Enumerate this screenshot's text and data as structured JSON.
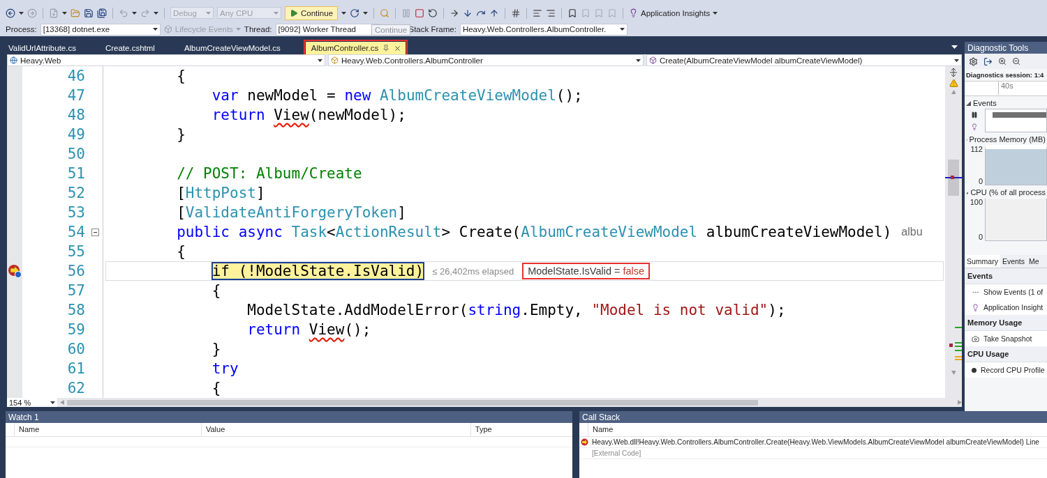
{
  "toolbar": {
    "configuration": {
      "value": "Debug",
      "disabled": true
    },
    "platform": {
      "value": "Any CPU",
      "disabled": true
    },
    "continue_button": "Continue",
    "insights": "Application Insights"
  },
  "debug_location": {
    "process_label": "Process:",
    "process": "[13368] dotnet.exe",
    "lifecycle": {
      "label": "Lifecycle Events",
      "disabled": true
    },
    "thread_label": "Thread:",
    "thread": "[9092] Worker Thread",
    "tooltip": "Continue",
    "stack_frame_label": "Stack Frame:",
    "stack_frame": "Heavy.Web.Controllers.AlbumController."
  },
  "tabs": [
    {
      "label": "ValidUrlAttribute.cs",
      "selected": false,
      "annotated": false
    },
    {
      "label": "Create.cshtml",
      "selected": false,
      "annotated": false
    },
    {
      "label": "AlbumCreateViewModel.cs",
      "selected": false,
      "annotated": false
    },
    {
      "label": "AlbumController.cs",
      "selected": true,
      "annotated": true
    }
  ],
  "navigation": {
    "project": "Heavy.Web",
    "type": "Heavy.Web.Controllers.AlbumController",
    "member": "Create(AlbumCreateViewModel albumCreateViewModel)"
  },
  "editor": {
    "zoom": "154 %",
    "lines": [
      {
        "number": "46",
        "current": false,
        "segments": [
          {
            "kind": "plain",
            "text": "        {"
          }
        ]
      },
      {
        "number": "47",
        "current": false,
        "segments": [
          {
            "kind": "keyword",
            "text": "            var"
          },
          {
            "kind": "plain",
            "text": " newModel = "
          },
          {
            "kind": "keyword",
            "text": "new "
          },
          {
            "kind": "type",
            "text": "AlbumCreateViewModel"
          },
          {
            "kind": "plain",
            "text": "();"
          }
        ]
      },
      {
        "number": "48",
        "current": false,
        "segments": [
          {
            "kind": "keyword",
            "text": "            return "
          },
          {
            "kind": "error",
            "text": "View"
          },
          {
            "kind": "plain",
            "text": "(newModel);"
          }
        ]
      },
      {
        "number": "49",
        "current": false,
        "segments": [
          {
            "kind": "plain",
            "text": "        }"
          }
        ]
      },
      {
        "number": "50",
        "current": false
      },
      {
        "number": "51",
        "current": false,
        "segments": [
          {
            "kind": "comment",
            "text": "        // POST: Album/Create"
          }
        ]
      },
      {
        "number": "52",
        "current": false,
        "segments": [
          {
            "kind": "plain",
            "text": "        ["
          },
          {
            "kind": "type",
            "text": "HttpPost"
          },
          {
            "kind": "plain",
            "text": "]"
          }
        ]
      },
      {
        "number": "53",
        "current": false,
        "segments": [
          {
            "kind": "plain",
            "text": "        ["
          },
          {
            "kind": "type",
            "text": "ValidateAntiForgeryToken"
          },
          {
            "kind": "plain",
            "text": "]"
          }
        ]
      },
      {
        "number": "54",
        "current": false,
        "fold": {
          "expanded": true
        },
        "hint": "albu",
        "segments": [
          {
            "kind": "keyword",
            "text": "        public async "
          },
          {
            "kind": "type",
            "text": "Task"
          },
          {
            "kind": "plain",
            "text": "<"
          },
          {
            "kind": "type",
            "text": "ActionResult"
          },
          {
            "kind": "plain",
            "text": "> Create("
          },
          {
            "kind": "type",
            "text": "AlbumCreateViewModel"
          },
          {
            "kind": "plain",
            "text": " albumCreateViewModel)"
          }
        ]
      },
      {
        "number": "55",
        "current": false,
        "segments": [
          {
            "kind": "plain",
            "text": "        {"
          }
        ]
      },
      {
        "number": "56",
        "current": true,
        "elapsed": "≤ 26,402ms elapsed",
        "datatip": {
          "expression": "ModelState.IsValid",
          "operator": "=",
          "value": "false",
          "annotated": true
        },
        "segments": [
          {
            "kind": "statement",
            "text": "            if (!ModelState.IsValid)"
          }
        ]
      },
      {
        "number": "57",
        "current": false,
        "segments": [
          {
            "kind": "plain",
            "text": "            {"
          }
        ]
      },
      {
        "number": "58",
        "current": false,
        "segments": [
          {
            "kind": "plain",
            "text": "                ModelState.AddModelError("
          },
          {
            "kind": "keyword",
            "text": "string"
          },
          {
            "kind": "plain",
            "text": ".Empty, "
          },
          {
            "kind": "string",
            "text": "\"Model is not valid\""
          },
          {
            "kind": "plain",
            "text": ");"
          }
        ]
      },
      {
        "number": "59",
        "current": false,
        "segments": [
          {
            "kind": "keyword",
            "text": "                return "
          },
          {
            "kind": "error",
            "text": "View"
          },
          {
            "kind": "plain",
            "text": "();"
          }
        ]
      },
      {
        "number": "60",
        "current": false,
        "segments": [
          {
            "kind": "plain",
            "text": "            }"
          }
        ]
      },
      {
        "number": "61",
        "current": false,
        "segments": [
          {
            "kind": "keyword",
            "text": "            try"
          }
        ]
      },
      {
        "number": "62",
        "current": false,
        "segments": [
          {
            "kind": "plain",
            "text": "            {"
          }
        ]
      }
    ]
  },
  "diagnostics": {
    "title": "Diagnostic Tools",
    "session": "Diagnostics session: 1:4",
    "time_tick": "40s",
    "events_title": "Events",
    "memory": {
      "title": "Process Memory (MB)",
      "max": "112",
      "min": "0"
    },
    "cpu": {
      "title": "CPU (% of all process",
      "max": "100",
      "min": "0"
    },
    "tabs": [
      {
        "label": "Summary",
        "selected": true
      },
      {
        "label": "Events",
        "selected": false
      },
      {
        "label": "Me",
        "selected": false
      }
    ],
    "groups": [
      {
        "heading": "Events",
        "items": [
          {
            "kind": "events",
            "label": "Show Events (1 of"
          },
          {
            "kind": "insights",
            "label": "Application Insight"
          }
        ]
      },
      {
        "heading": "Memory Usage",
        "items": [
          {
            "kind": "snapshot",
            "label": "Take Snapshot"
          }
        ]
      },
      {
        "heading": "CPU Usage",
        "items": [
          {
            "kind": "record",
            "label": "Record CPU Profile"
          }
        ]
      }
    ]
  },
  "watch": {
    "title": "Watch 1",
    "columns": [
      "Name",
      "Value",
      "Type"
    ]
  },
  "call_stack": {
    "title": "Call Stack",
    "columns": [
      "Name"
    ],
    "frames": [
      {
        "kind": "frame",
        "current": true,
        "text": "Heavy.Web.dll!Heavy.Web.Controllers.AlbumController.Create(Heavy.Web.ViewModels.AlbumCreateViewModel albumCreateViewModel) Line"
      },
      {
        "kind": "external",
        "current": false,
        "text": "[External Code]"
      }
    ]
  }
}
